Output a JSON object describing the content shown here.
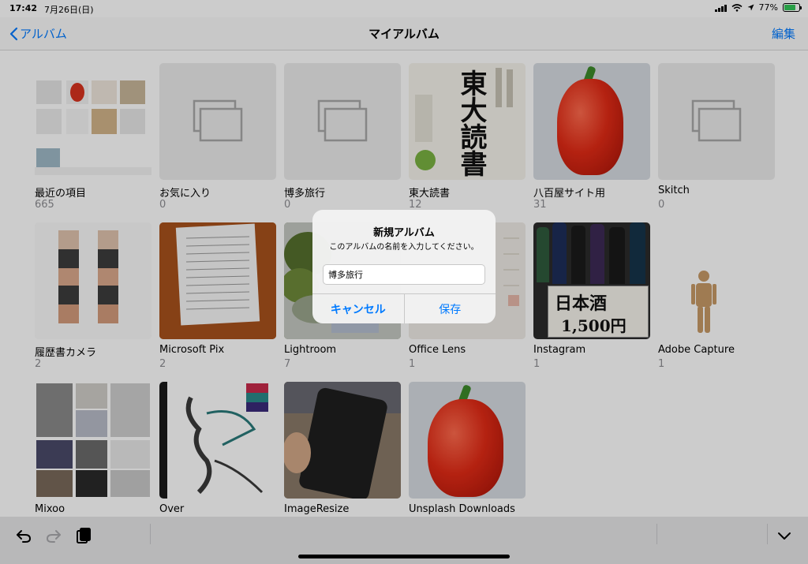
{
  "status_bar": {
    "time": "17:42",
    "date": "7月26日(日)",
    "battery": "77%"
  },
  "nav": {
    "back_label": "アルバム",
    "title": "マイアルバム",
    "edit_label": "編集"
  },
  "albums": [
    {
      "name": "最近の項目",
      "count": "665",
      "thumb": "collage"
    },
    {
      "name": "お気に入り",
      "count": "0",
      "thumb": "placeholder"
    },
    {
      "name": "博多旅行",
      "count": "0",
      "thumb": "placeholder"
    },
    {
      "name": "東大読書",
      "count": "12",
      "thumb": "book",
      "book_text": "東大読書"
    },
    {
      "name": "八百屋サイト用",
      "count": "31",
      "thumb": "pepper"
    },
    {
      "name": "Skitch",
      "count": "0",
      "thumb": "placeholder"
    },
    {
      "name": "履歴書カメラ",
      "count": "2",
      "thumb": "mosaic"
    },
    {
      "name": "Microsoft Pix",
      "count": "2",
      "thumb": "document"
    },
    {
      "name": "Lightroom",
      "count": "7",
      "thumb": "plants"
    },
    {
      "name": "Office Lens",
      "count": "1",
      "thumb": "paper"
    },
    {
      "name": "Instagram",
      "count": "1",
      "thumb": "sake",
      "sign_text": "日本酒",
      "sign_price": "1,500円"
    },
    {
      "name": "Adobe Capture",
      "count": "1",
      "thumb": "figure"
    },
    {
      "name": "Mixoo",
      "count": "",
      "thumb": "grid"
    },
    {
      "name": "Over",
      "count": "",
      "thumb": "dragon"
    },
    {
      "name": "ImageResize",
      "count": "",
      "thumb": "phone"
    },
    {
      "name": "Unsplash Downloads",
      "count": "",
      "thumb": "pepper"
    }
  ],
  "dialog": {
    "title": "新規アルバム",
    "message": "このアルバムの名前を入力してください。",
    "input_value": "博多旅行",
    "cancel_label": "キャンセル",
    "save_label": "保存"
  },
  "colors": {
    "accent": "#007aff",
    "secondary_text": "#8e8e93"
  },
  "toolbar": {
    "icons": [
      "undo-icon",
      "redo-icon",
      "clipboard-icon",
      "chevron-down-icon"
    ]
  }
}
